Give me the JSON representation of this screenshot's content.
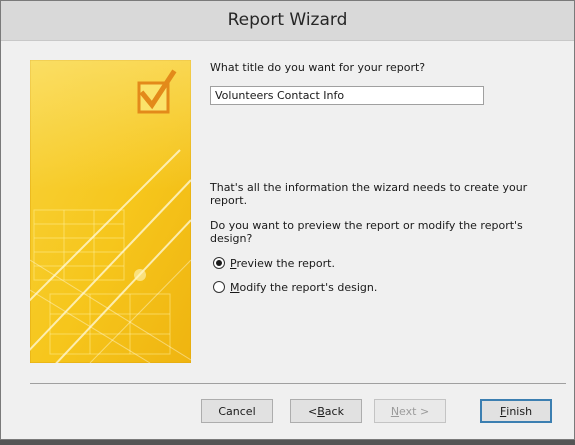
{
  "window": {
    "title": "Report Wizard"
  },
  "title_question": "What title do you want for your report?",
  "report_title_value": "Volunteers Contact Info",
  "info_text": "That's all the information the wizard needs to create your report.",
  "preview_question": "Do you want to preview the report or modify the report's design?",
  "options": [
    {
      "accel": "P",
      "rest": "review the report.",
      "checked": true
    },
    {
      "accel": "M",
      "rest": "odify the report's design.",
      "checked": false
    }
  ],
  "buttons": {
    "cancel": {
      "pre": "Cancel",
      "accel": "",
      "rest": ""
    },
    "back": {
      "pre": "< ",
      "accel": "B",
      "rest": "ack"
    },
    "next": {
      "pre": "",
      "accel": "N",
      "rest": "ext >"
    },
    "finish": {
      "pre": "",
      "accel": "F",
      "rest": "inish"
    }
  },
  "colors": {
    "art_yellow": "#f6c61c",
    "art_light": "#fbe36a",
    "check_orange": "#e38a1a",
    "titlebar": "#d9d9d9",
    "default_button_border": "#3c7fb1"
  },
  "icons": {
    "checkmark": "check-icon"
  }
}
